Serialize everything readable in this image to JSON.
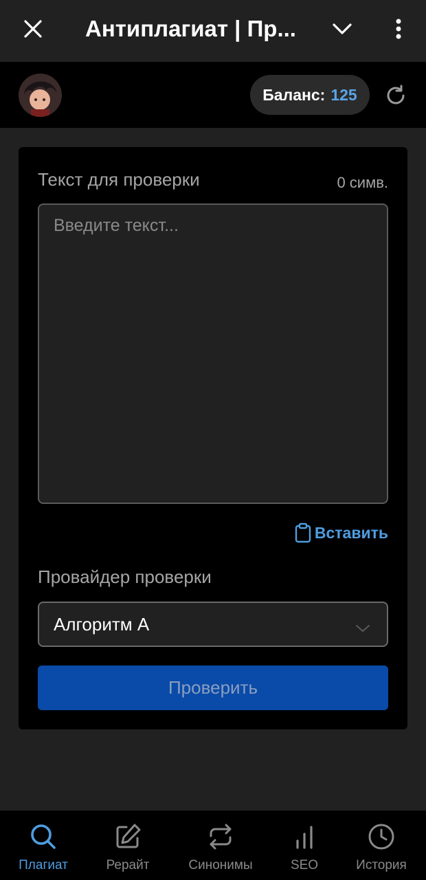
{
  "app": {
    "title": "Антиплагиат | Пр..."
  },
  "header": {
    "balance_label": "Баланс:",
    "balance_value": "125"
  },
  "form": {
    "text_label": "Текст для проверки",
    "char_count": "0 симв.",
    "text_placeholder": "Введите текст...",
    "text_value": "",
    "paste_label": "Вставить",
    "provider_label": "Провайдер проверки",
    "provider_selected": "Алгоритм А",
    "submit_label": "Проверить"
  },
  "nav": {
    "items": [
      {
        "label": "Плагиат",
        "icon": "search-icon",
        "active": true
      },
      {
        "label": "Рерайт",
        "icon": "edit-icon",
        "active": false
      },
      {
        "label": "Синонимы",
        "icon": "swap-icon",
        "active": false
      },
      {
        "label": "SEO",
        "icon": "bar-chart-icon",
        "active": false
      },
      {
        "label": "История",
        "icon": "clock-icon",
        "active": false
      }
    ]
  },
  "colors": {
    "accent": "#4f9de0",
    "balance_value": "#5aa5e6",
    "submit_bg": "#0a4aa8",
    "card_bg": "#000000",
    "page_bg": "#212121"
  }
}
